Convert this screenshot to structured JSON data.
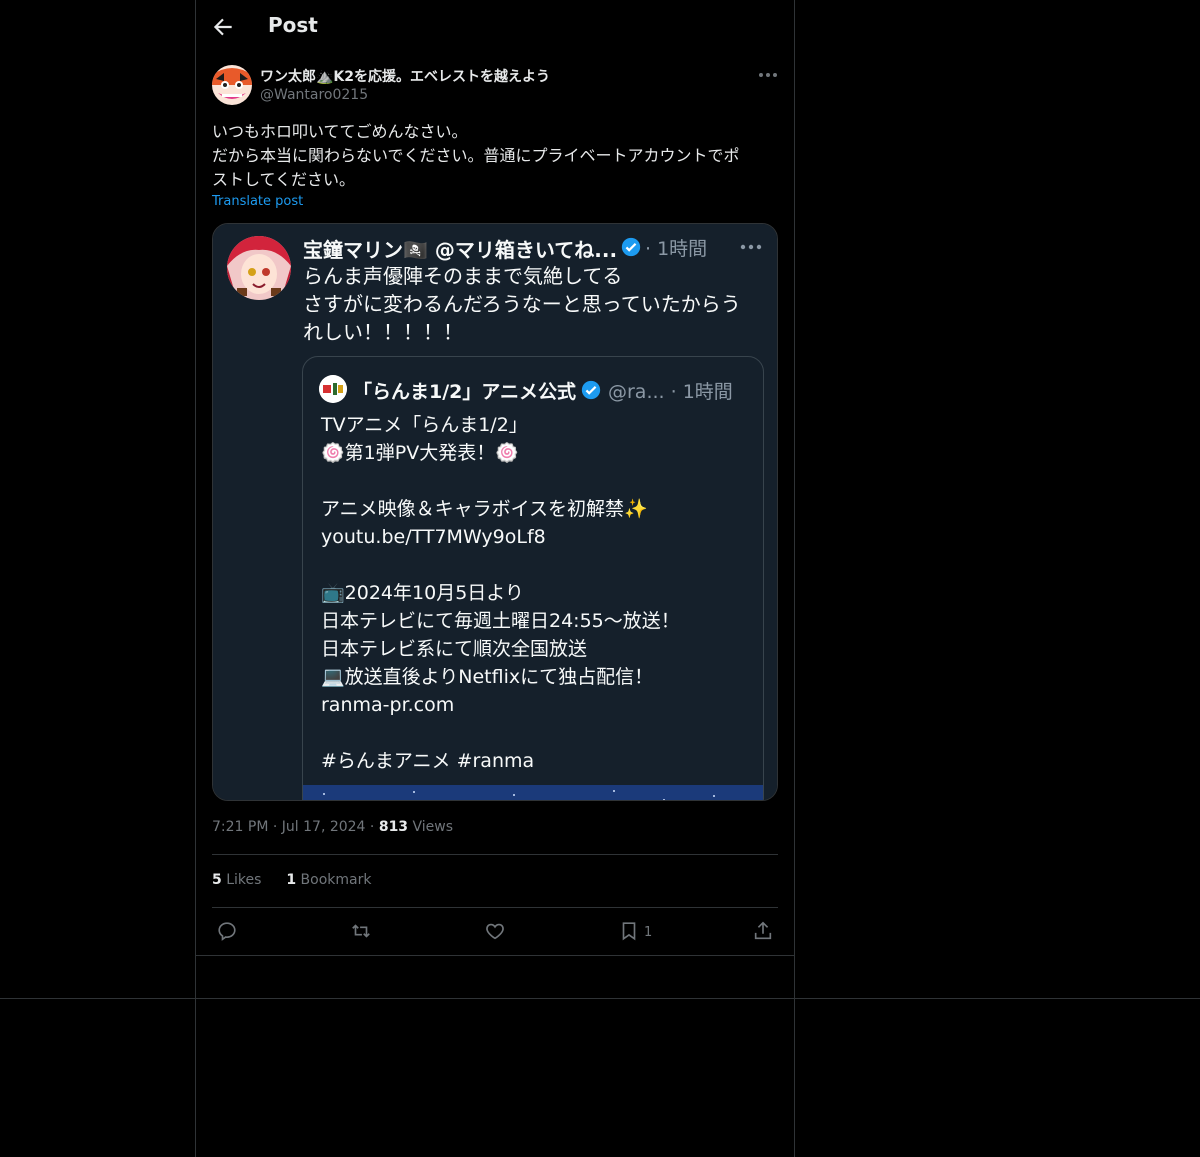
{
  "header": {
    "title": "Post"
  },
  "post": {
    "author_name": "ワン太郎⛰️K2を応援。エベレストを越えよう",
    "author_handle": "@Wantaro0215",
    "text_lines": [
      "いつもホロ叩いててごめんなさい。",
      "だから本当に関わらないでください。普通にプライベートアカウントでポ",
      "ストしてください。"
    ],
    "translate_label": "Translate post",
    "time": "7:21 PM",
    "date": "Jul 17, 2024",
    "views_count": "813",
    "views_label": "Views",
    "likes_count": "5",
    "likes_label": "Likes",
    "bookmarks_count": "1",
    "bookmarks_label": "Bookmark",
    "bookmark_action_count": "1"
  },
  "embedded_screenshot": {
    "author_name": "宝鐘マリン🏴‍☠️ @マリ箱きいてね...",
    "time": "· 1時間",
    "text_lines": [
      "らんま声優陣そのままで気絶してる",
      "さすがに変わるんだろうなーと思っていたからう",
      "れしい！！！！！"
    ],
    "quote": {
      "author_name": "「らんま1/2」アニメ公式",
      "meta": "@ra... · 1時間",
      "text_lines": [
        "TVアニメ「らんま1/2」",
        "🍥第1弾PV大発表！🍥",
        "",
        "アニメ映像＆キャラボイスを初解禁✨",
        "youtu.be/TT7MWy9oLf8",
        "",
        "📺2024年10月5日より",
        "日本テレビにて毎週土曜日24:55〜放送！",
        "日本テレビ系にて順次全国放送",
        "💻放送直後よりNetflixにて独占配信！",
        "ranma-pr.com",
        "",
        "#らんまアニメ #ranma"
      ]
    }
  },
  "colors": {
    "background": "#000000",
    "text": "#e7e9ea",
    "secondary": "#71767b",
    "accent": "#1d9bf0",
    "border": "#2f3336"
  },
  "icons": {
    "back": "arrow-left-icon",
    "more": "ellipsis-icon",
    "reply": "reply-icon",
    "repost": "repost-icon",
    "like": "heart-icon",
    "bookmark": "bookmark-icon",
    "share": "share-icon",
    "verified": "verified-badge-icon"
  }
}
